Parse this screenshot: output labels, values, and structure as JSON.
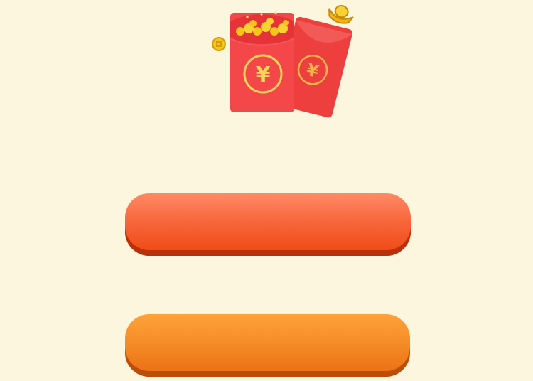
{
  "illustration": {
    "name": "red-envelopes",
    "currency_symbol": "¥"
  },
  "buttons": {
    "primary_label": "",
    "secondary_label": ""
  },
  "colors": {
    "background": "#fdf6de",
    "primary_button": "#f7663b",
    "secondary_button": "#f58a25",
    "envelope_red": "#f4474a",
    "gold": "#f5c518"
  }
}
